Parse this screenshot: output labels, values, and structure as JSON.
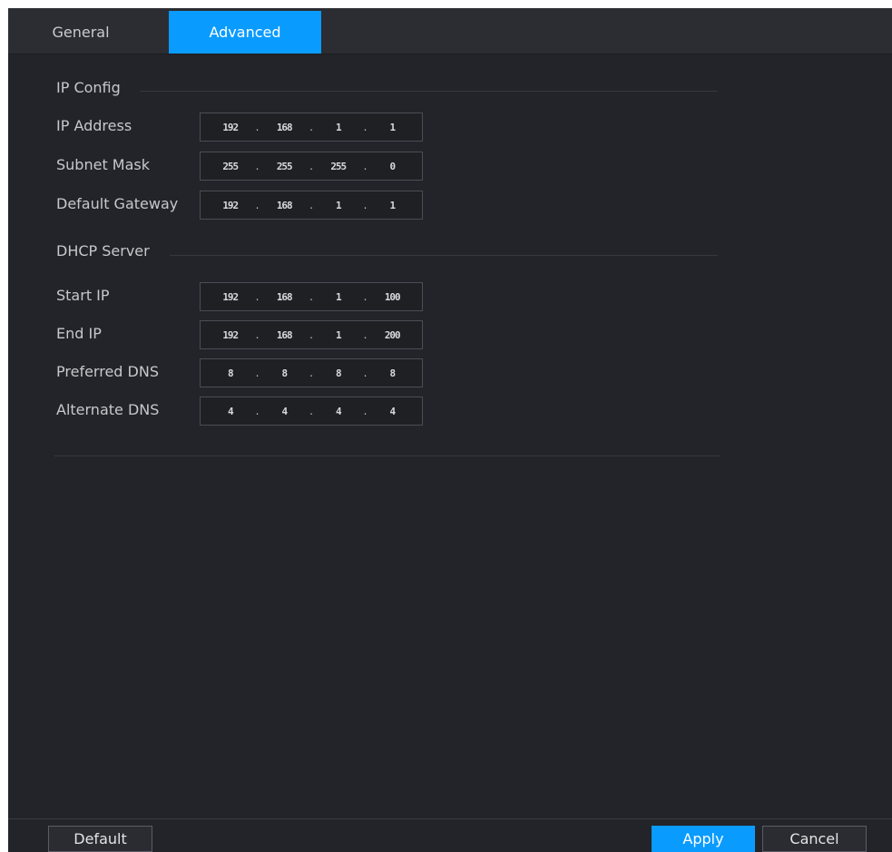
{
  "tabs": {
    "general": "General",
    "advanced": "Advanced"
  },
  "ip_config": {
    "title": "IP Config",
    "ip_address_label": "IP Address",
    "ip_address": [
      "192",
      "168",
      "1",
      "1"
    ],
    "subnet_mask_label": "Subnet Mask",
    "subnet_mask": [
      "255",
      "255",
      "255",
      "0"
    ],
    "default_gateway_label": "Default Gateway",
    "default_gateway": [
      "192",
      "168",
      "1",
      "1"
    ]
  },
  "dhcp_server": {
    "title": "DHCP Server",
    "start_ip_label": "Start IP",
    "start_ip": [
      "192",
      "168",
      "1",
      "100"
    ],
    "end_ip_label": "End IP",
    "end_ip": [
      "192",
      "168",
      "1",
      "200"
    ],
    "preferred_dns_label": "Preferred DNS",
    "preferred_dns": [
      "8",
      "8",
      "8",
      "8"
    ],
    "alternate_dns_label": "Alternate DNS",
    "alternate_dns": [
      "4",
      "4",
      "4",
      "4"
    ]
  },
  "buttons": {
    "default": "Default",
    "apply": "Apply",
    "cancel": "Cancel"
  }
}
